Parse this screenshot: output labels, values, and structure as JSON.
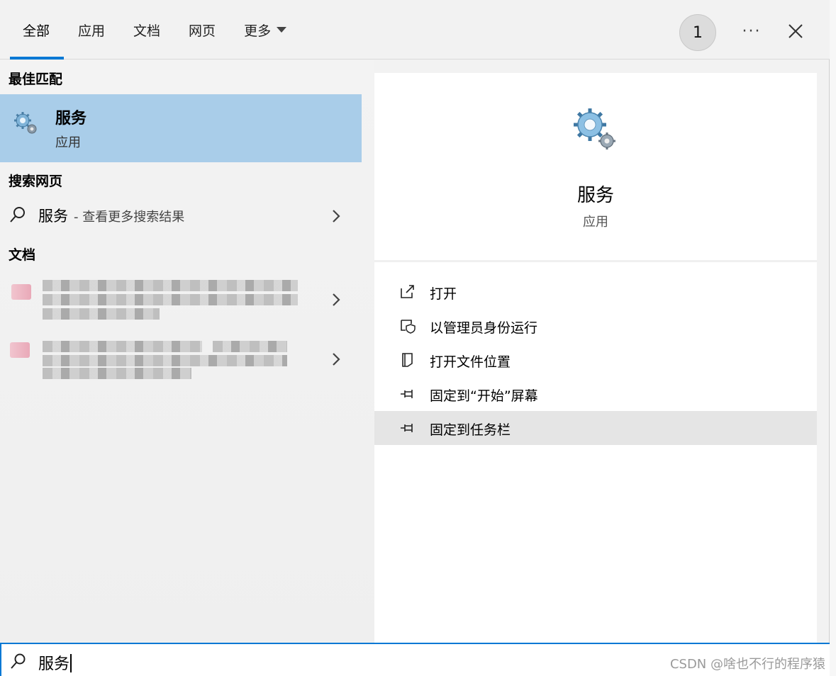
{
  "tabs": [
    {
      "label": "全部",
      "active": true
    },
    {
      "label": "应用",
      "active": false
    },
    {
      "label": "文档",
      "active": false
    },
    {
      "label": "网页",
      "active": false
    },
    {
      "label": "更多",
      "active": false
    }
  ],
  "header": {
    "badge": "1",
    "more_dots": "···"
  },
  "left": {
    "best_match_title": "最佳匹配",
    "best_match": {
      "name": "服务",
      "kind": "应用",
      "icon": "gears-icon"
    },
    "web_title": "搜索网页",
    "web_item": {
      "main": "服务",
      "sub": "- 查看更多搜索结果"
    },
    "docs_title": "文档"
  },
  "right": {
    "title": "服务",
    "subtitle": "应用",
    "actions": [
      {
        "label": "打开",
        "icon": "open-external-icon"
      },
      {
        "label": "以管理员身份运行",
        "icon": "shield-run-icon"
      },
      {
        "label": "打开文件位置",
        "icon": "file-location-icon"
      },
      {
        "label": "固定到“开始”屏幕",
        "icon": "pin-icon"
      },
      {
        "label": "固定到任务栏",
        "icon": "pin-icon"
      }
    ]
  },
  "search": {
    "query": "服务",
    "watermark": "CSDN @啥也不行的程序猿"
  },
  "colors": {
    "accent": "#0078d4",
    "selection": "#a9cde9",
    "hover": "#e5e5e5"
  }
}
